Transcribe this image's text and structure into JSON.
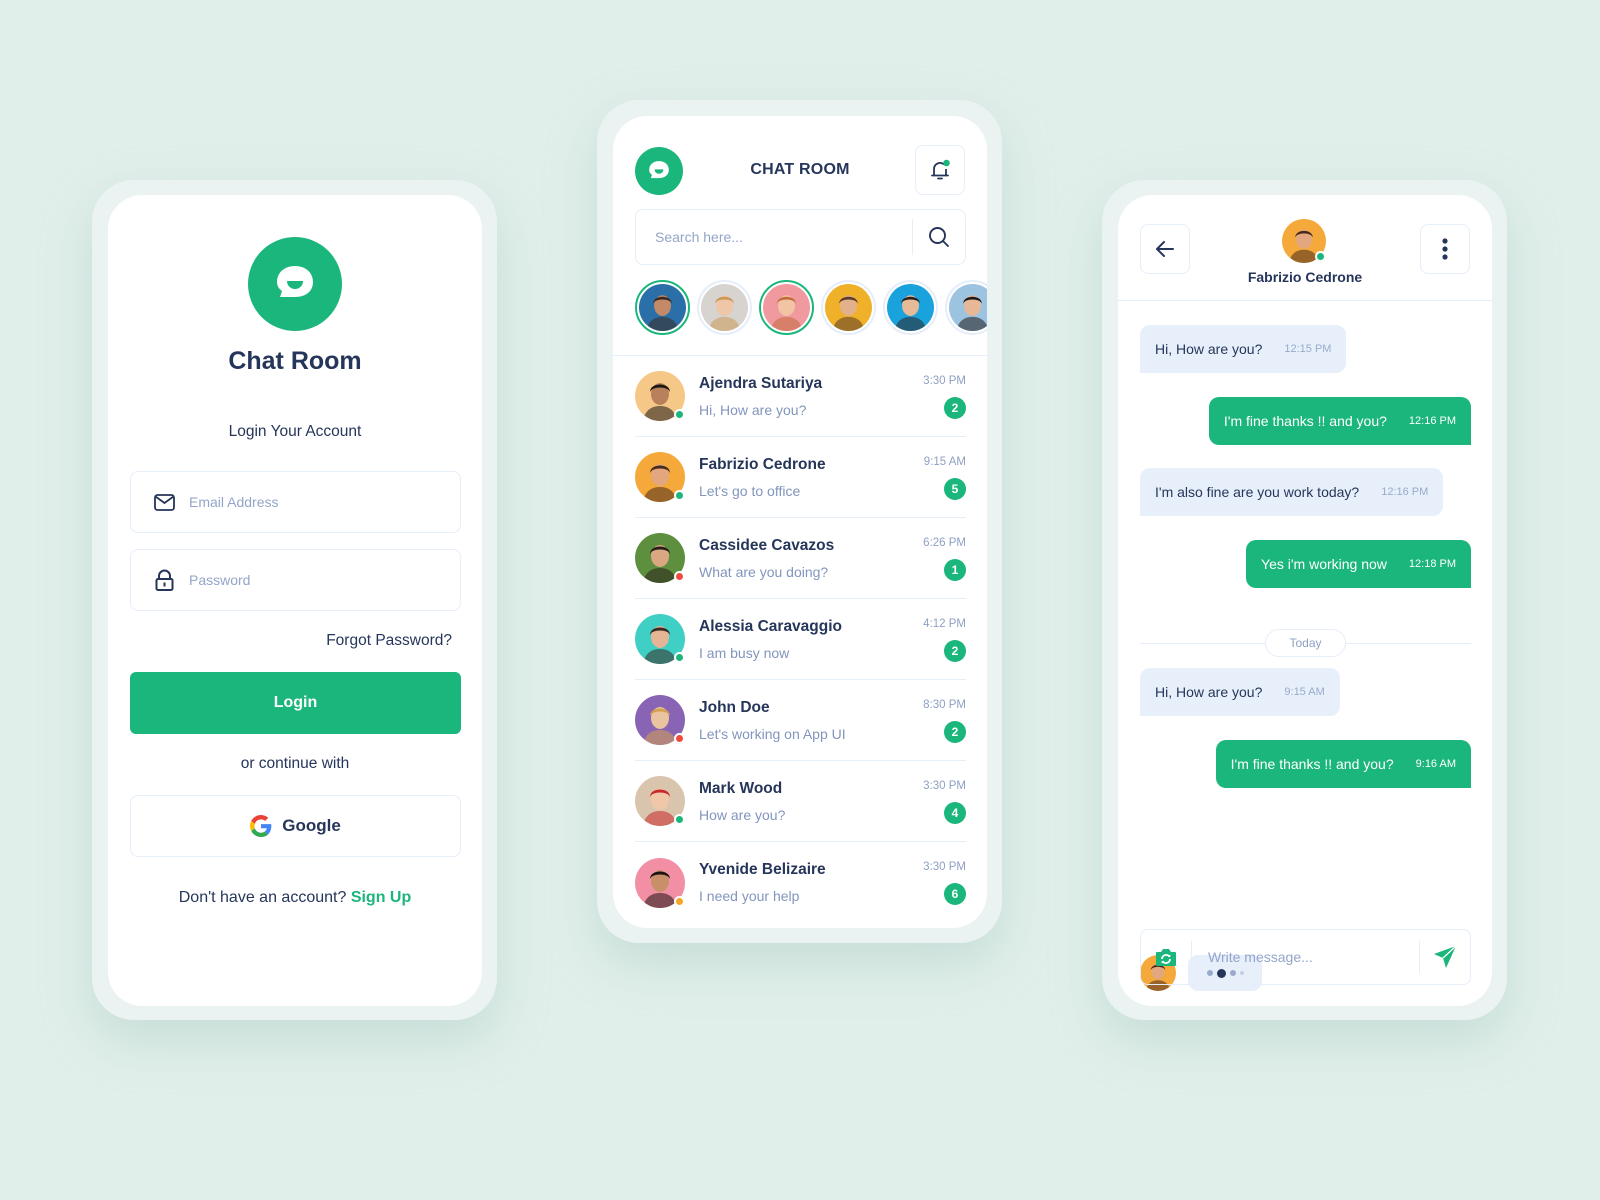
{
  "colors": {
    "background": "#e1efea",
    "brand": "#1bb67b",
    "text_dark": "#26365a",
    "text_muted": "#8295bd",
    "bubble_incoming": "#e7effb",
    "status_online": "#1bb67b",
    "status_busy": "#ef4a3c",
    "status_away": "#f5a623"
  },
  "login": {
    "app_title": "Chat Room",
    "subtitle": "Login Your Account",
    "email_placeholder": "Email Address",
    "password_placeholder": "Password",
    "forgot_password": "Forgot Password?",
    "login_button": "Login",
    "or_continue": "or continue with",
    "google_button": "Google",
    "no_account_text": "Don't have an account?",
    "signup_link": "Sign Up"
  },
  "chat_list": {
    "title": "CHAT ROOM",
    "search_placeholder": "Search here...",
    "stories": [
      {
        "name": "story-1",
        "active": true,
        "bg": "#2a6fa8",
        "skin": "#c48a68",
        "hair": "#3a2a20"
      },
      {
        "name": "story-2",
        "active": false,
        "bg": "#d7d3cf",
        "skin": "#f0c6a8",
        "hair": "#c89a58"
      },
      {
        "name": "story-3",
        "active": true,
        "bg": "#f09aa0",
        "skin": "#f2c4a4",
        "hair": "#c26a3a"
      },
      {
        "name": "story-4",
        "active": false,
        "bg": "#f0b12a",
        "skin": "#e3b08c",
        "hair": "#5a3a28"
      },
      {
        "name": "story-5",
        "active": false,
        "bg": "#1aa2dd",
        "skin": "#e8bb98",
        "hair": "#2b2220"
      },
      {
        "name": "story-6",
        "active": false,
        "bg": "#9cc4e0",
        "skin": "#e6b898",
        "hair": "#1e1a1a"
      }
    ],
    "chats": [
      {
        "name": "Ajendra Sutariya",
        "preview": "Hi, How are you?",
        "time": "3:30 PM",
        "unread": "2",
        "status": "online",
        "bg": "#f5c887",
        "skin": "#b9805c",
        "hair": "#1c1816"
      },
      {
        "name": "Fabrizio Cedrone",
        "preview": "Let's go to office",
        "time": "9:15 AM",
        "unread": "5",
        "status": "online",
        "bg": "#f5a93a",
        "skin": "#e2a77e",
        "hair": "#4a2a1a"
      },
      {
        "name": "Cassidee Cavazos",
        "preview": "What are you doing?",
        "time": "6:26 PM",
        "unread": "1",
        "status": "busy",
        "bg": "#5e8f3e",
        "skin": "#d9a883",
        "hair": "#2a1f18"
      },
      {
        "name": "Alessia Caravaggio",
        "preview": "I am busy now",
        "time": "4:12 PM",
        "unread": "2",
        "status": "online",
        "bg": "#3fcfc4",
        "skin": "#e5b596",
        "hair": "#3a2a22"
      },
      {
        "name": "John Doe",
        "preview": "Let's working on App UI",
        "time": "8:30 PM",
        "unread": "2",
        "status": "busy",
        "bg": "#8a64b4",
        "skin": "#eac3a0",
        "hair": "#d4a050"
      },
      {
        "name": "Mark Wood",
        "preview": "How are you?",
        "time": "3:30 PM",
        "unread": "4",
        "status": "online",
        "bg": "#d9c4ae",
        "skin": "#f0c7a8",
        "hair": "#c8282a"
      },
      {
        "name": "Yvenide Belizaire",
        "preview": "I need your help",
        "time": "3:30 PM",
        "unread": "6",
        "status": "away",
        "bg": "#f38fa5",
        "skin": "#c8906a",
        "hair": "#1c1410"
      }
    ]
  },
  "conversation": {
    "contact_name": "Fabrizio Cedrone",
    "contact_status": "online",
    "messages": [
      {
        "direction": "in",
        "text": "Hi, How are you?",
        "time": "12:15 PM"
      },
      {
        "direction": "out",
        "text": "I'm fine thanks !! and you?",
        "time": "12:16 PM"
      },
      {
        "direction": "in",
        "text": "I'm also fine are you work today?",
        "time": "12:16 PM"
      },
      {
        "direction": "out",
        "text": "Yes i'm working now",
        "time": "12:18 PM"
      },
      {
        "direction": "in",
        "text": "Hi, How are you?",
        "time": "9:15 AM"
      },
      {
        "direction": "out",
        "text": "I'm fine thanks !! and you?",
        "time": "9:16 AM"
      }
    ],
    "day_separator": "Today",
    "typing": true,
    "composer_placeholder": "Write message..."
  },
  "icons": {
    "logo": "chat-bubble-smile-icon",
    "email": "envelope-icon",
    "password": "lock-icon",
    "google": "google-g-icon",
    "notification": "bell-icon",
    "search": "search-icon",
    "back": "arrow-left-icon",
    "more": "vertical-dots-icon",
    "camera": "camera-switch-icon",
    "send": "send-arrow-icon"
  }
}
